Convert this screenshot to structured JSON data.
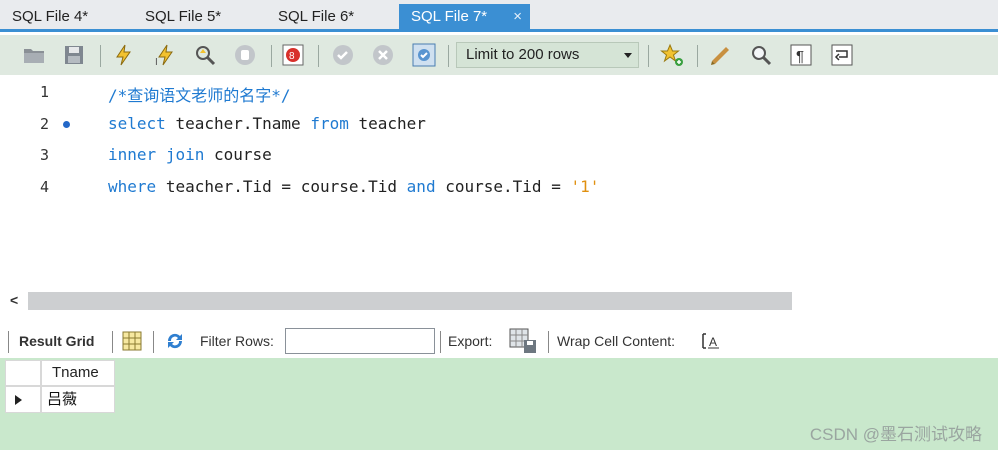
{
  "tabs": [
    {
      "label": "SQL File 4*",
      "active": false
    },
    {
      "label": "SQL File 5*",
      "active": false
    },
    {
      "label": "SQL File 6*",
      "active": false
    },
    {
      "label": "SQL File 7*",
      "active": true
    }
  ],
  "tab_close_glyph": "×",
  "toolbar": {
    "icons": [
      "open-folder-icon",
      "save-icon",
      "execute-icon",
      "execute-current-icon",
      "explain-icon",
      "stop-icon",
      "toggle-continue-on-error-icon",
      "commit-icon",
      "rollback-icon",
      "autocommit-icon",
      "add-snippet-icon",
      "beautify-icon",
      "find-icon",
      "invisible-chars-icon",
      "wrap-lines-icon"
    ],
    "limit_label": "Limit to 200 rows"
  },
  "editor": {
    "lines": [
      {
        "num": "1",
        "text": "/*查询语文老师的名字*/"
      },
      {
        "num": "2",
        "text": "select teacher.Tname from teacher"
      },
      {
        "num": "3",
        "text": "inner join course"
      },
      {
        "num": "4",
        "text": "where teacher.Tid = course.Tid and course.Tid = '1'"
      }
    ]
  },
  "result_toolbar": {
    "result_grid_label": "Result Grid",
    "filter_rows_label": "Filter Rows:",
    "filter_value": "",
    "export_label": "Export:",
    "wrap_label": "Wrap Cell Content:"
  },
  "grid": {
    "columns": [
      "Tname"
    ],
    "rows": [
      [
        "吕薇"
      ]
    ]
  },
  "watermark": "CSDN @墨石测试攻略",
  "colors": {
    "accent": "#3b8fd3",
    "keyword": "#1f7ad1",
    "string": "#e09010",
    "grid_bg": "#c9e8cc"
  }
}
